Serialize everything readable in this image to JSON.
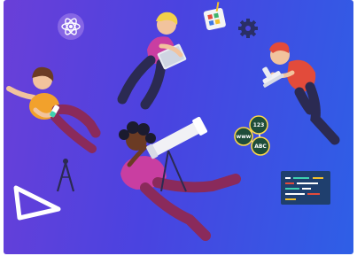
{
  "colors": {
    "bg_left": "#6a3fd8",
    "bg_mid": "#4a43e0",
    "bg_right": "#2e5fe6",
    "skin_dark": "#6b3b24",
    "skin_light": "#f2c39d",
    "shirt_orange": "#f2a12c",
    "shirt_pink": "#c93ea1",
    "shirt_red": "#e24b3b",
    "pants_dark": "#2b2a52",
    "pants_plum": "#8a2a5b",
    "node_green": "#1f4d3a",
    "node_yellow": "#ffd84a",
    "code_panel": "#1f3f6e"
  },
  "graph_nodes": {
    "top_label": "123",
    "left_label": "www",
    "bottom_label": "ABC"
  },
  "icons": [
    "atom-icon",
    "paint-palette-icon",
    "gear-icon",
    "compass-tool-icon",
    "triangle-ruler-icon",
    "code-editor-icon",
    "microscope-icon",
    "telescope-icon",
    "laptop-icon",
    "test-tube-icon"
  ]
}
